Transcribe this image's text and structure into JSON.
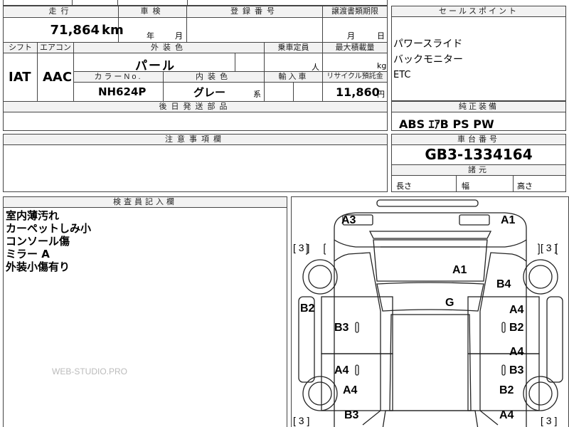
{
  "top_strip": {
    "partial_text": "□□□"
  },
  "left_panel": {
    "mileage_label": "走行",
    "mileage_value": "71,864",
    "mileage_unit": "km",
    "inspection_label": "車検",
    "inspection_year_unit": "年",
    "inspection_month_unit": "月",
    "registration_label": "登録番号",
    "transfer_deadline_label": "譲渡書類期限",
    "transfer_month_unit": "月",
    "transfer_day_unit": "日",
    "shift_label": "シフト",
    "shift_value": "IAT",
    "aircon_label": "エアコン",
    "aircon_value": "AAC",
    "exterior_color_label": "外装色",
    "exterior_color_value": "パール",
    "capacity_label": "乗車定員",
    "capacity_unit": "人",
    "max_load_label": "最大積載量",
    "max_load_unit": "kg",
    "color_no_label": "カラーNo.",
    "color_no_value": "NH624P",
    "interior_color_label": "内装色",
    "interior_color_value": "グレー",
    "interior_suffix": "系",
    "import_label": "輸入車",
    "recycle_label": "リサイクル預託金",
    "recycle_value": "11,860",
    "recycle_unit": "円",
    "later_parts_label": "後日発送部品"
  },
  "sales_points": {
    "header": "セールスポイント",
    "items": [
      "パワースライド",
      "バックモニター",
      "ETC"
    ]
  },
  "genuine_equipment": {
    "header": "純正装備",
    "value": "ABS ｴｱB PS PW"
  },
  "caution": {
    "header": "注意事項欄"
  },
  "chassis": {
    "header": "車台番号",
    "value": "GB3-1334164"
  },
  "dimensions": {
    "header": "諸元",
    "length_label": "長さ",
    "width_label": "幅",
    "height_label": "高さ"
  },
  "inspector": {
    "header": "検査員記入欄",
    "notes": [
      "室内薄汚れ",
      "カーペットしみ小",
      "コンソール傷",
      "ミラー A",
      "外装小傷有り"
    ]
  },
  "watermark": "WEB-STUDIO.PRO",
  "diagram": {
    "marks": {
      "a3": "A3",
      "a1_top": "A1",
      "a1_center": "A1",
      "b4": "B4",
      "g": "G",
      "b2_left": "B2",
      "a4_r1": "A4",
      "b2_r1": "B2",
      "b3_left": "B3",
      "a4_r2": "A4",
      "b3_r2": "B3",
      "a4_left1": "A4",
      "a4_left2": "A4",
      "b2_r3": "B2",
      "b3_left2": "B3",
      "a4_r3": "A4"
    },
    "tires": {
      "tl": "[ 3 ]",
      "tr": "[ 3 ]",
      "bl": "[ 3 ]",
      "br": "[ 3 ]"
    }
  }
}
